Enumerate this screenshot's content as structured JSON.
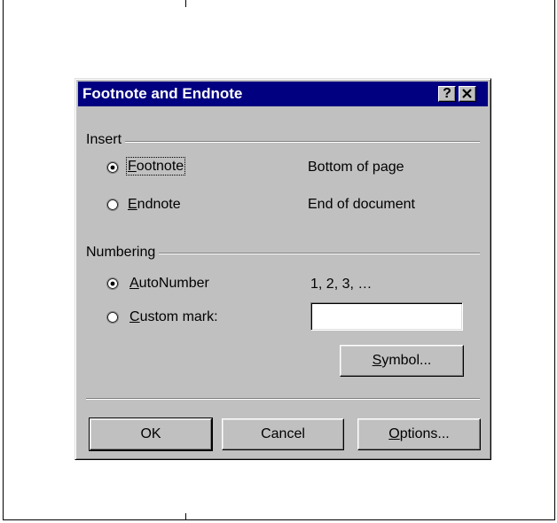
{
  "dialog": {
    "title": "Footnote and Endnote",
    "help_button": "?",
    "close_button": "✕"
  },
  "insert": {
    "group_label": "Insert",
    "options": [
      {
        "label": "Footnote",
        "mnemonic": "F",
        "rest": "ootnote",
        "description": "Bottom of page",
        "selected": true
      },
      {
        "label": "Endnote",
        "mnemonic": "E",
        "rest": "ndnote",
        "description": "End of document",
        "selected": false
      }
    ]
  },
  "numbering": {
    "group_label": "Numbering",
    "autonumber": {
      "label": "AutoNumber",
      "mnemonic": "A",
      "rest": "utoNumber",
      "description": "1, 2, 3, …",
      "selected": true
    },
    "custom": {
      "label": "Custom mark:",
      "mnemonic": "C",
      "rest": "ustom mark:",
      "selected": false,
      "value": ""
    },
    "symbol_button": {
      "mnemonic": "S",
      "rest": "ymbol..."
    }
  },
  "buttons": {
    "ok": "OK",
    "cancel": "Cancel",
    "options": {
      "mnemonic": "O",
      "rest": "ptions..."
    }
  }
}
